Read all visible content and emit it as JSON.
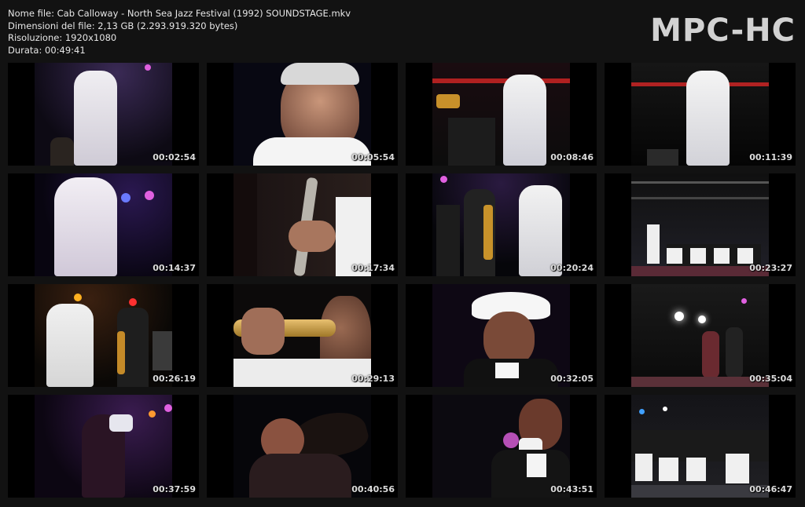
{
  "info": {
    "filename": "Nome file: Cab Calloway - North Sea Jazz Festival (1992) SOUNDSTAGE.mkv",
    "size": "Dimensioni del file: 2,13 GB (2.293.919.320 bytes)",
    "resolution": "Risoluzione: 1920x1080",
    "duration": "Durata: 00:49:41"
  },
  "logo": "MPC-HC",
  "thumbs": [
    {
      "time": "00:02:54"
    },
    {
      "time": "00:05:54"
    },
    {
      "time": "00:08:46"
    },
    {
      "time": "00:11:39"
    },
    {
      "time": "00:14:37"
    },
    {
      "time": "00:17:34"
    },
    {
      "time": "00:20:24"
    },
    {
      "time": "00:23:27"
    },
    {
      "time": "00:26:19"
    },
    {
      "time": "00:29:13"
    },
    {
      "time": "00:32:05"
    },
    {
      "time": "00:35:04"
    },
    {
      "time": "00:37:59"
    },
    {
      "time": "00:40:56"
    },
    {
      "time": "00:43:51"
    },
    {
      "time": "00:46:47"
    }
  ]
}
